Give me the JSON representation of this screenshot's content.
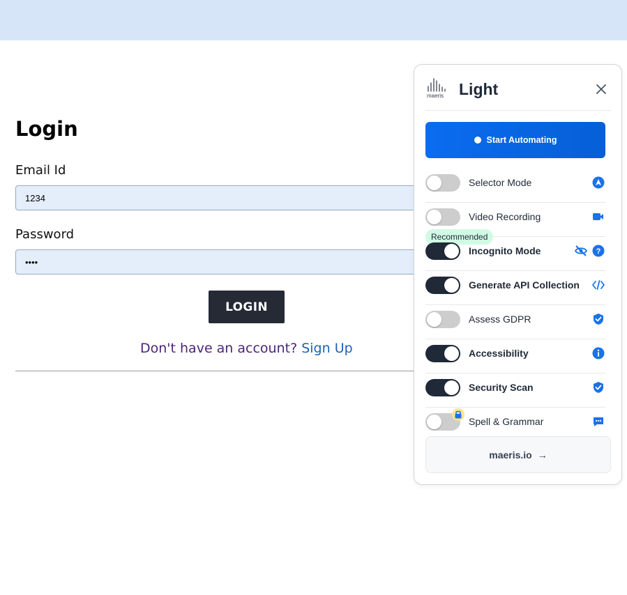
{
  "page": {
    "login_title": "Login",
    "email_label": "Email Id",
    "email_value": "1234",
    "password_label": "Password",
    "password_value": "••••",
    "login_button": "LOGIN",
    "signup_prompt": "Don't have an account?",
    "signup_link": "Sign Up"
  },
  "extension": {
    "brand": "Light",
    "logo_text": "maeris",
    "close_icon": "close-icon",
    "start_button": "Start Automating",
    "recommended_badge": "Recommended",
    "options": [
      {
        "label": "Selector Mode",
        "enabled": false,
        "bold": false,
        "icon": "cursor-circle-icon"
      },
      {
        "label": "Video Recording",
        "enabled": false,
        "bold": false,
        "icon": "video-camera-icon"
      },
      {
        "label": "Incognito Mode",
        "enabled": true,
        "bold": true,
        "icon": "eye-off-icon",
        "extra_icon": "help-icon"
      },
      {
        "label": "Generate API Collection",
        "enabled": true,
        "bold": true,
        "icon": "code-icon"
      },
      {
        "label": "Assess GDPR",
        "enabled": false,
        "bold": false,
        "icon": "shield-check-icon"
      },
      {
        "label": "Accessibility",
        "enabled": true,
        "bold": true,
        "icon": "info-icon"
      },
      {
        "label": "Security Scan",
        "enabled": true,
        "bold": true,
        "icon": "shield-check-icon"
      },
      {
        "label": "Spell & Grammar",
        "enabled": false,
        "bold": false,
        "icon": "chat-bubble-icon",
        "locked": true
      }
    ],
    "footer_link": "maeris.io",
    "footer_arrow": "→",
    "colors": {
      "accent": "#0a6cf0",
      "toggle_on": "#1f2937",
      "toggle_off": "#cdcdcd",
      "icon_blue": "#1a73e8"
    }
  }
}
